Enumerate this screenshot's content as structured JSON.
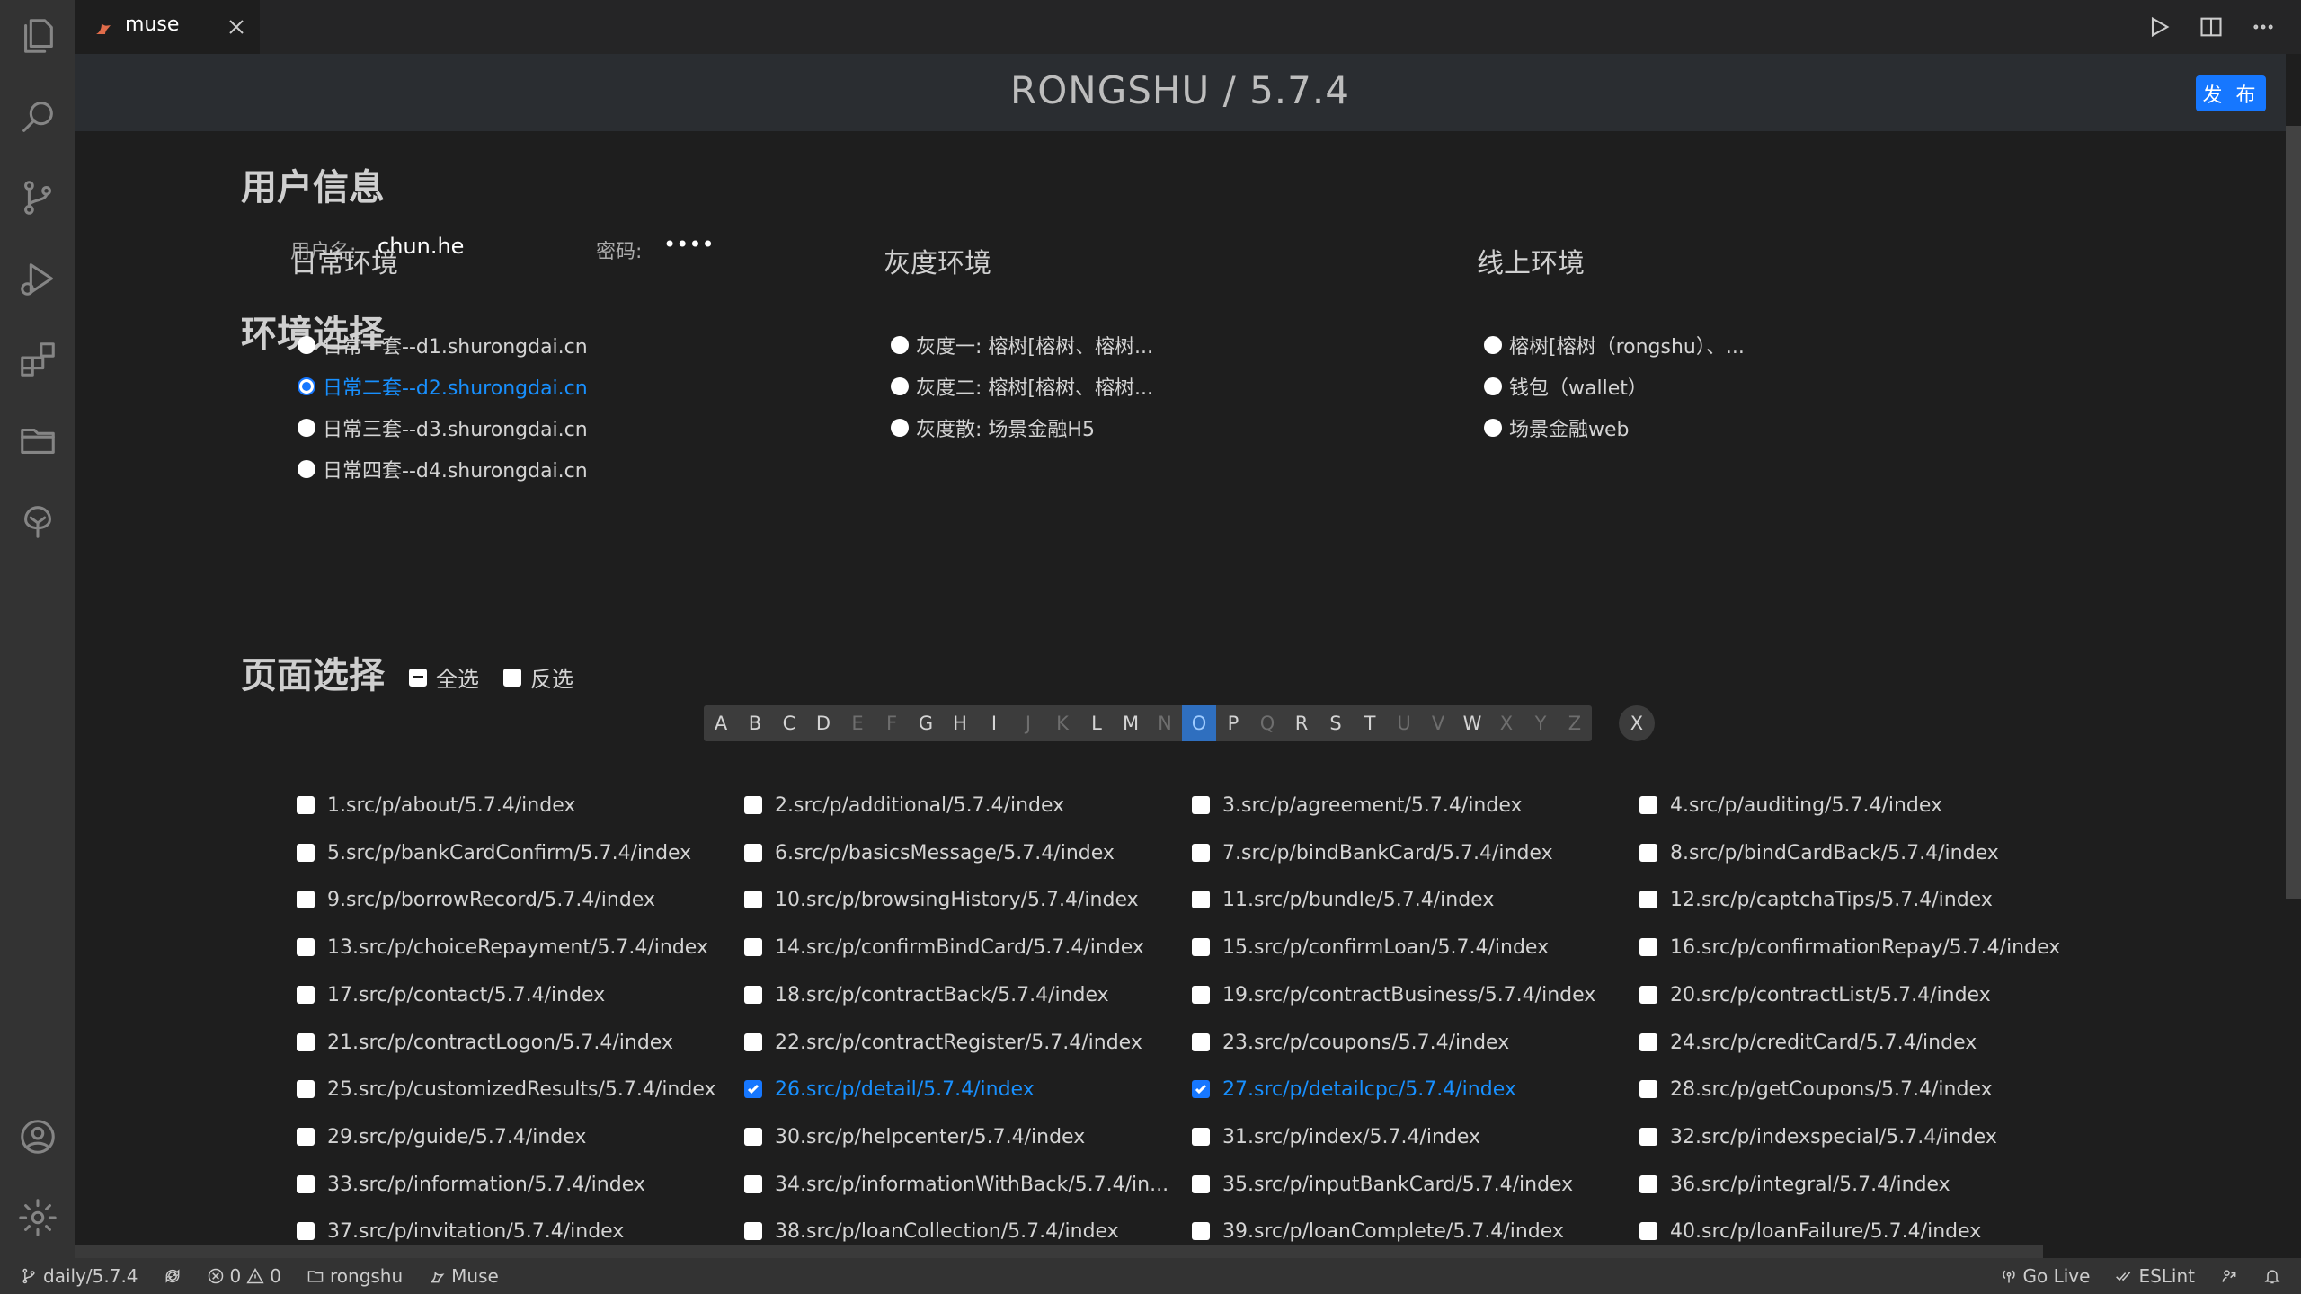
{
  "tab": {
    "label": "muse"
  },
  "header": {
    "title": "RONGSHU / 5.7.4",
    "publish_label": "发 布"
  },
  "user_section": {
    "title": "用户信息",
    "username_label": "用户名:",
    "username_value": "chun.he",
    "password_label": "密码:",
    "password_value": "••••"
  },
  "env_section": {
    "title": "环境选择",
    "groups": [
      {
        "title": "日常环境",
        "options": [
          "日常一套--d1.shurongdai.cn",
          "日常二套--d2.shurongdai.cn",
          "日常三套--d3.shurongdai.cn",
          "日常四套--d4.shurongdai.cn"
        ],
        "selected_index": 1
      },
      {
        "title": "灰度环境",
        "options": [
          "灰度一: 榕树[榕树、榕树...",
          "灰度二: 榕树[榕树、榕树...",
          "灰度散: 场景金融H5"
        ],
        "selected_index": -1
      },
      {
        "title": "线上环境",
        "options": [
          "榕树[榕树（rongshu）、...",
          "钱包（wallet）",
          "场景金融web"
        ],
        "selected_index": -1
      }
    ]
  },
  "page_section": {
    "title": "页面选择",
    "select_all_label": "全选",
    "invert_label": "反选",
    "alphabet": [
      {
        "l": "A",
        "s": "n"
      },
      {
        "l": "B",
        "s": "n"
      },
      {
        "l": "C",
        "s": "n"
      },
      {
        "l": "D",
        "s": "n"
      },
      {
        "l": "E",
        "s": "d"
      },
      {
        "l": "F",
        "s": "d"
      },
      {
        "l": "G",
        "s": "n"
      },
      {
        "l": "H",
        "s": "n"
      },
      {
        "l": "I",
        "s": "n"
      },
      {
        "l": "J",
        "s": "d"
      },
      {
        "l": "K",
        "s": "d"
      },
      {
        "l": "L",
        "s": "n"
      },
      {
        "l": "M",
        "s": "n"
      },
      {
        "l": "N",
        "s": "d"
      },
      {
        "l": "O",
        "s": "a"
      },
      {
        "l": "P",
        "s": "n"
      },
      {
        "l": "Q",
        "s": "d"
      },
      {
        "l": "R",
        "s": "n"
      },
      {
        "l": "S",
        "s": "n"
      },
      {
        "l": "T",
        "s": "n"
      },
      {
        "l": "U",
        "s": "d"
      },
      {
        "l": "V",
        "s": "d"
      },
      {
        "l": "W",
        "s": "n"
      },
      {
        "l": "X",
        "s": "d"
      },
      {
        "l": "Y",
        "s": "d"
      },
      {
        "l": "Z",
        "s": "d"
      }
    ],
    "clear_label": "X",
    "pages": [
      "1.src/p/about/5.7.4/index",
      "2.src/p/additional/5.7.4/index",
      "3.src/p/agreement/5.7.4/index",
      "4.src/p/auditing/5.7.4/index",
      "5.src/p/bankCardConfirm/5.7.4/index",
      "6.src/p/basicsMessage/5.7.4/index",
      "7.src/p/bindBankCard/5.7.4/index",
      "8.src/p/bindCardBack/5.7.4/index",
      "9.src/p/borrowRecord/5.7.4/index",
      "10.src/p/browsingHistory/5.7.4/index",
      "11.src/p/bundle/5.7.4/index",
      "12.src/p/captchaTips/5.7.4/index",
      "13.src/p/choiceRepayment/5.7.4/index",
      "14.src/p/confirmBindCard/5.7.4/index",
      "15.src/p/confirmLoan/5.7.4/index",
      "16.src/p/confirmationRepay/5.7.4/index",
      "17.src/p/contact/5.7.4/index",
      "18.src/p/contractBack/5.7.4/index",
      "19.src/p/contractBusiness/5.7.4/index",
      "20.src/p/contractList/5.7.4/index",
      "21.src/p/contractLogon/5.7.4/index",
      "22.src/p/contractRegister/5.7.4/index",
      "23.src/p/coupons/5.7.4/index",
      "24.src/p/creditCard/5.7.4/index",
      "25.src/p/customizedResults/5.7.4/index",
      "26.src/p/detail/5.7.4/index",
      "27.src/p/detailcpc/5.7.4/index",
      "28.src/p/getCoupons/5.7.4/index",
      "29.src/p/guide/5.7.4/index",
      "30.src/p/helpcenter/5.7.4/index",
      "31.src/p/index/5.7.4/index",
      "32.src/p/indexspecial/5.7.4/index",
      "33.src/p/information/5.7.4/index",
      "34.src/p/informationWithBack/5.7.4/in...",
      "35.src/p/inputBankCard/5.7.4/index",
      "36.src/p/integral/5.7.4/index",
      "37.src/p/invitation/5.7.4/index",
      "38.src/p/loanCollection/5.7.4/index",
      "39.src/p/loanComplete/5.7.4/index",
      "40.src/p/loanFailure/5.7.4/index"
    ],
    "checked_pages": [
      25,
      26
    ]
  },
  "statusbar": {
    "branch": "daily/5.7.4",
    "errors": "0",
    "warnings": "0",
    "folder": "rongshu",
    "extension": "Muse",
    "go_live": "Go Live",
    "eslint": "ESLint"
  },
  "colors": {
    "accent": "#1677ff",
    "selected_text": "#1890ff",
    "background": "#1e1e1e",
    "header": "#2a2d31"
  }
}
